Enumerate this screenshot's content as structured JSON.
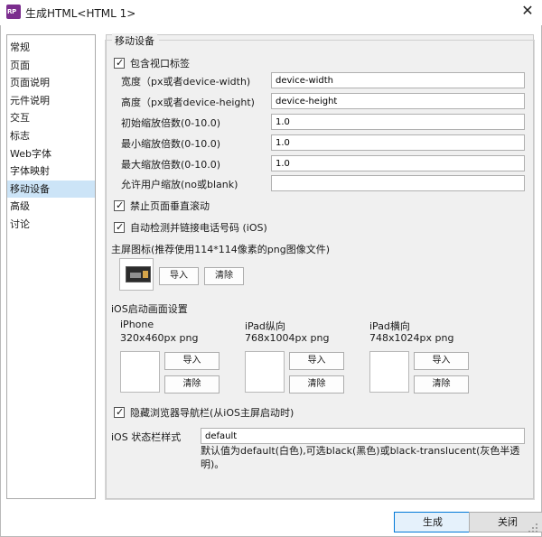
{
  "window": {
    "app_icon_text": "RP",
    "title": "生成HTML<HTML 1>",
    "close_glyph": "✕"
  },
  "sidebar": {
    "items": [
      {
        "label": "常规"
      },
      {
        "label": "页面"
      },
      {
        "label": "页面说明"
      },
      {
        "label": "元件说明"
      },
      {
        "label": "交互"
      },
      {
        "label": "标志"
      },
      {
        "label": "Web字体"
      },
      {
        "label": "字体映射"
      },
      {
        "label": "移动设备",
        "selected": true
      },
      {
        "label": "高级"
      },
      {
        "label": "讨论"
      }
    ]
  },
  "panel": {
    "title": "移动设备",
    "include_viewport": {
      "label": "包含视口标签",
      "checked": true
    },
    "fields": [
      {
        "label": "宽度（px或者device-width)",
        "value": "device-width"
      },
      {
        "label": "高度（px或者device-height)",
        "value": "device-height"
      },
      {
        "label": "初始缩放倍数(0-10.0)",
        "value": "1.0"
      },
      {
        "label": "最小缩放倍数(0-10.0)",
        "value": "1.0"
      },
      {
        "label": "最大缩放倍数(0-10.0)",
        "value": "1.0"
      },
      {
        "label": "允许用户缩放(no或blank)",
        "value": ""
      }
    ],
    "disable_scroll": {
      "label": "禁止页面垂直滚动",
      "checked": true
    },
    "auto_detect_phone": {
      "label": "自动检测并链接电话号码 (iOS)",
      "checked": true
    },
    "home_icon": {
      "label": "主屏图标(推荐使用114*114像素的png图像文件)",
      "import_label": "导入",
      "clear_label": "清除"
    },
    "ios_startup": {
      "title": "iOS启动画面设置",
      "devices": [
        {
          "name": "iPhone",
          "size": "320x460px png",
          "import_label": "导入",
          "clear_label": "清除"
        },
        {
          "name": "iPad纵向",
          "size": "768x1004px png",
          "import_label": "导入",
          "clear_label": "清除"
        },
        {
          "name": "iPad横向",
          "size": "748x1024px png",
          "import_label": "导入",
          "clear_label": "清除"
        }
      ]
    },
    "hide_nav_bar": {
      "label": "隐藏浏览器导航栏(从iOS主屏启动时)",
      "checked": true
    },
    "status_bar": {
      "label": "iOS 状态栏样式",
      "value": "default",
      "hint_line1": "默认值为default(白色),可选black(黑色)或black-translucent(灰色半透",
      "hint_line2": "明)。"
    }
  },
  "footer": {
    "generate_label": "生成",
    "close_label": "关闭"
  }
}
